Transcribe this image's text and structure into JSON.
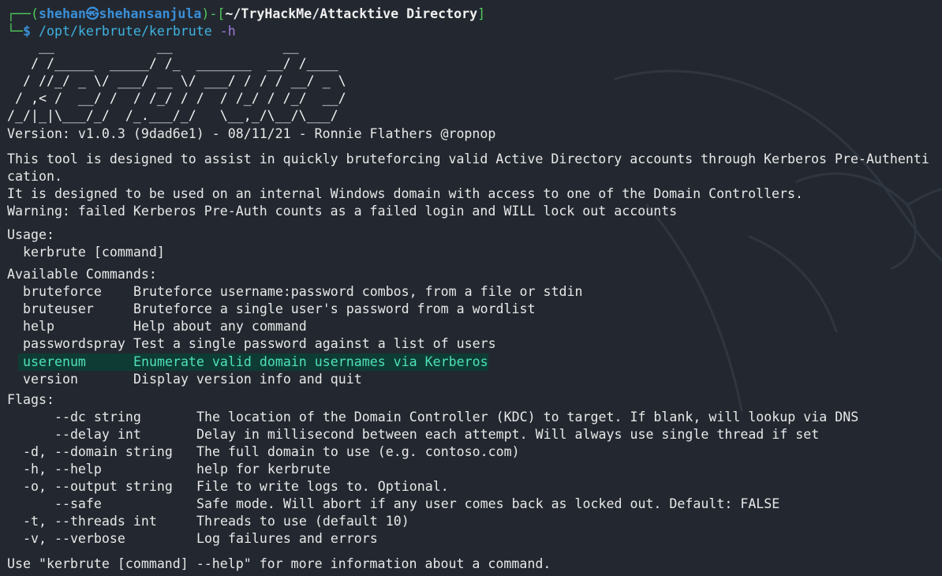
{
  "prompt": {
    "corner_top": "┌──(",
    "user": "shehan",
    "at": "㉿",
    "host": "shehansanjula",
    "sep": ")-[",
    "path": "~/TryHackMe/Attacktive Directory",
    "close": "]",
    "corner_bottom": "└─",
    "dollar": "$",
    "command": "/opt/kerbrute/kerbrute",
    "arg": "-h"
  },
  "ascii_banner": [
    "    __             __              __     ",
    "   / /_____  _____/ /_  _______  __/ /____ ",
    "  / //_/ _ \\/ ___/ __ \\/ ___/ / / / __/ _ \\",
    " / ,< /  __/ /  / /_/ / /  / /_/ / /_/  __/",
    "/_/|_|\\___/_/  /_.___/_/   \\__,_/\\__/\\___/ "
  ],
  "version_line": "Version: v1.0.3 (9dad6e1) - 08/11/21 - Ronnie Flathers @ropnop",
  "description": [
    "This tool is designed to assist in quickly bruteforcing valid Active Directory accounts through Kerberos Pre-Authenti",
    "cation.",
    "It is designed to be used on an internal Windows domain with access to one of the Domain Controllers.",
    "Warning: failed Kerberos Pre-Auth counts as a failed login and WILL lock out accounts"
  ],
  "usage_header": "Usage:",
  "usage_line": "  kerbrute [command]",
  "commands_header": "Available Commands:",
  "commands": [
    {
      "name": "bruteforce",
      "desc": "Bruteforce username:password combos, from a file or stdin"
    },
    {
      "name": "bruteuser",
      "desc": "Bruteforce a single user's password from a wordlist"
    },
    {
      "name": "help",
      "desc": "Help about any command"
    },
    {
      "name": "passwordspray",
      "desc": "Test a single password against a list of users"
    },
    {
      "name": "userenum",
      "desc": "Enumerate valid domain usernames via Kerberos"
    },
    {
      "name": "version",
      "desc": "Display version info and quit"
    }
  ],
  "flags_header": "Flags:",
  "flags": [
    {
      "name": "    --dc string",
      "desc": "The location of the Domain Controller (KDC) to target. If blank, will lookup via DNS"
    },
    {
      "name": "    --delay int",
      "desc": "Delay in millisecond between each attempt. Will always use single thread if set"
    },
    {
      "name": "-d, --domain string",
      "desc": "The full domain to use (e.g. contoso.com)"
    },
    {
      "name": "-h, --help",
      "desc": "help for kerbrute"
    },
    {
      "name": "-o, --output string",
      "desc": "File to write logs to. Optional."
    },
    {
      "name": "    --safe",
      "desc": "Safe mode. Will abort if any user comes back as locked out. Default: FALSE"
    },
    {
      "name": "-t, --threads int",
      "desc": "Threads to use (default 10)"
    },
    {
      "name": "-v, --verbose",
      "desc": "Log failures and errors"
    }
  ],
  "footer": "Use \"kerbrute [command] --help\" for more information about a command.",
  "colors": {
    "background": "#232830",
    "prompt_blue": "#3fb2e0",
    "prompt_green": "#4ec95b",
    "highlight_bg": "#0e3c34",
    "highlight_text": "#4fe0b8"
  }
}
